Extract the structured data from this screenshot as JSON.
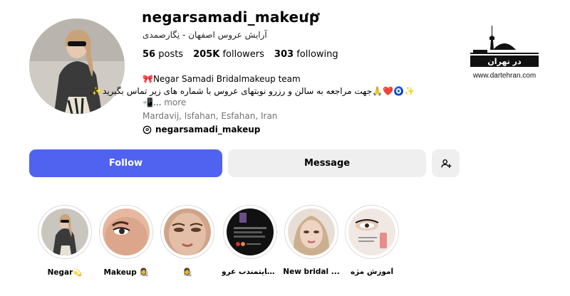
{
  "profile": {
    "username": "negarsamadi_makeup",
    "category": "آرایش عروس اصفهان - نِگارصمدی",
    "stats": {
      "posts_count": "56",
      "posts_label": "posts",
      "followers_count": "205K",
      "followers_label": "followers",
      "following_count": "303",
      "following_label": "following"
    },
    "bio": {
      "name_line": "🎀Negar Samadi Bridalmakeup team",
      "rtl_line": "✨🧿❤️🙏جهت مراجعه به سالن و رزرو نوبتهای عروس با شماره های زیر تماس بگیرید✨.",
      "more_line_prefix": "📲...",
      "more_label": "more"
    },
    "location": "Mardavij, Isfahan, Esfahan, Iran",
    "threads_handle": "negarsamadi_makeup"
  },
  "actions": {
    "follow_label": "Follow",
    "message_label": "Message",
    "add_user_icon": "person-plus-icon"
  },
  "highlights": [
    {
      "label": "Negar💫"
    },
    {
      "label": "Makeup 👩‍🎨"
    },
    {
      "label": "👩‍🎨"
    },
    {
      "label": "رضایتمندب عرو..."
    },
    {
      "label": "New bridal ..."
    },
    {
      "label": "آموزش مژه"
    }
  ],
  "watermark": {
    "url": "www.dartehran.com",
    "logo_text": "در تهران"
  },
  "colors": {
    "follow_button": "#4f63f0",
    "secondary_button": "#efefef",
    "muted_text": "#737373"
  }
}
